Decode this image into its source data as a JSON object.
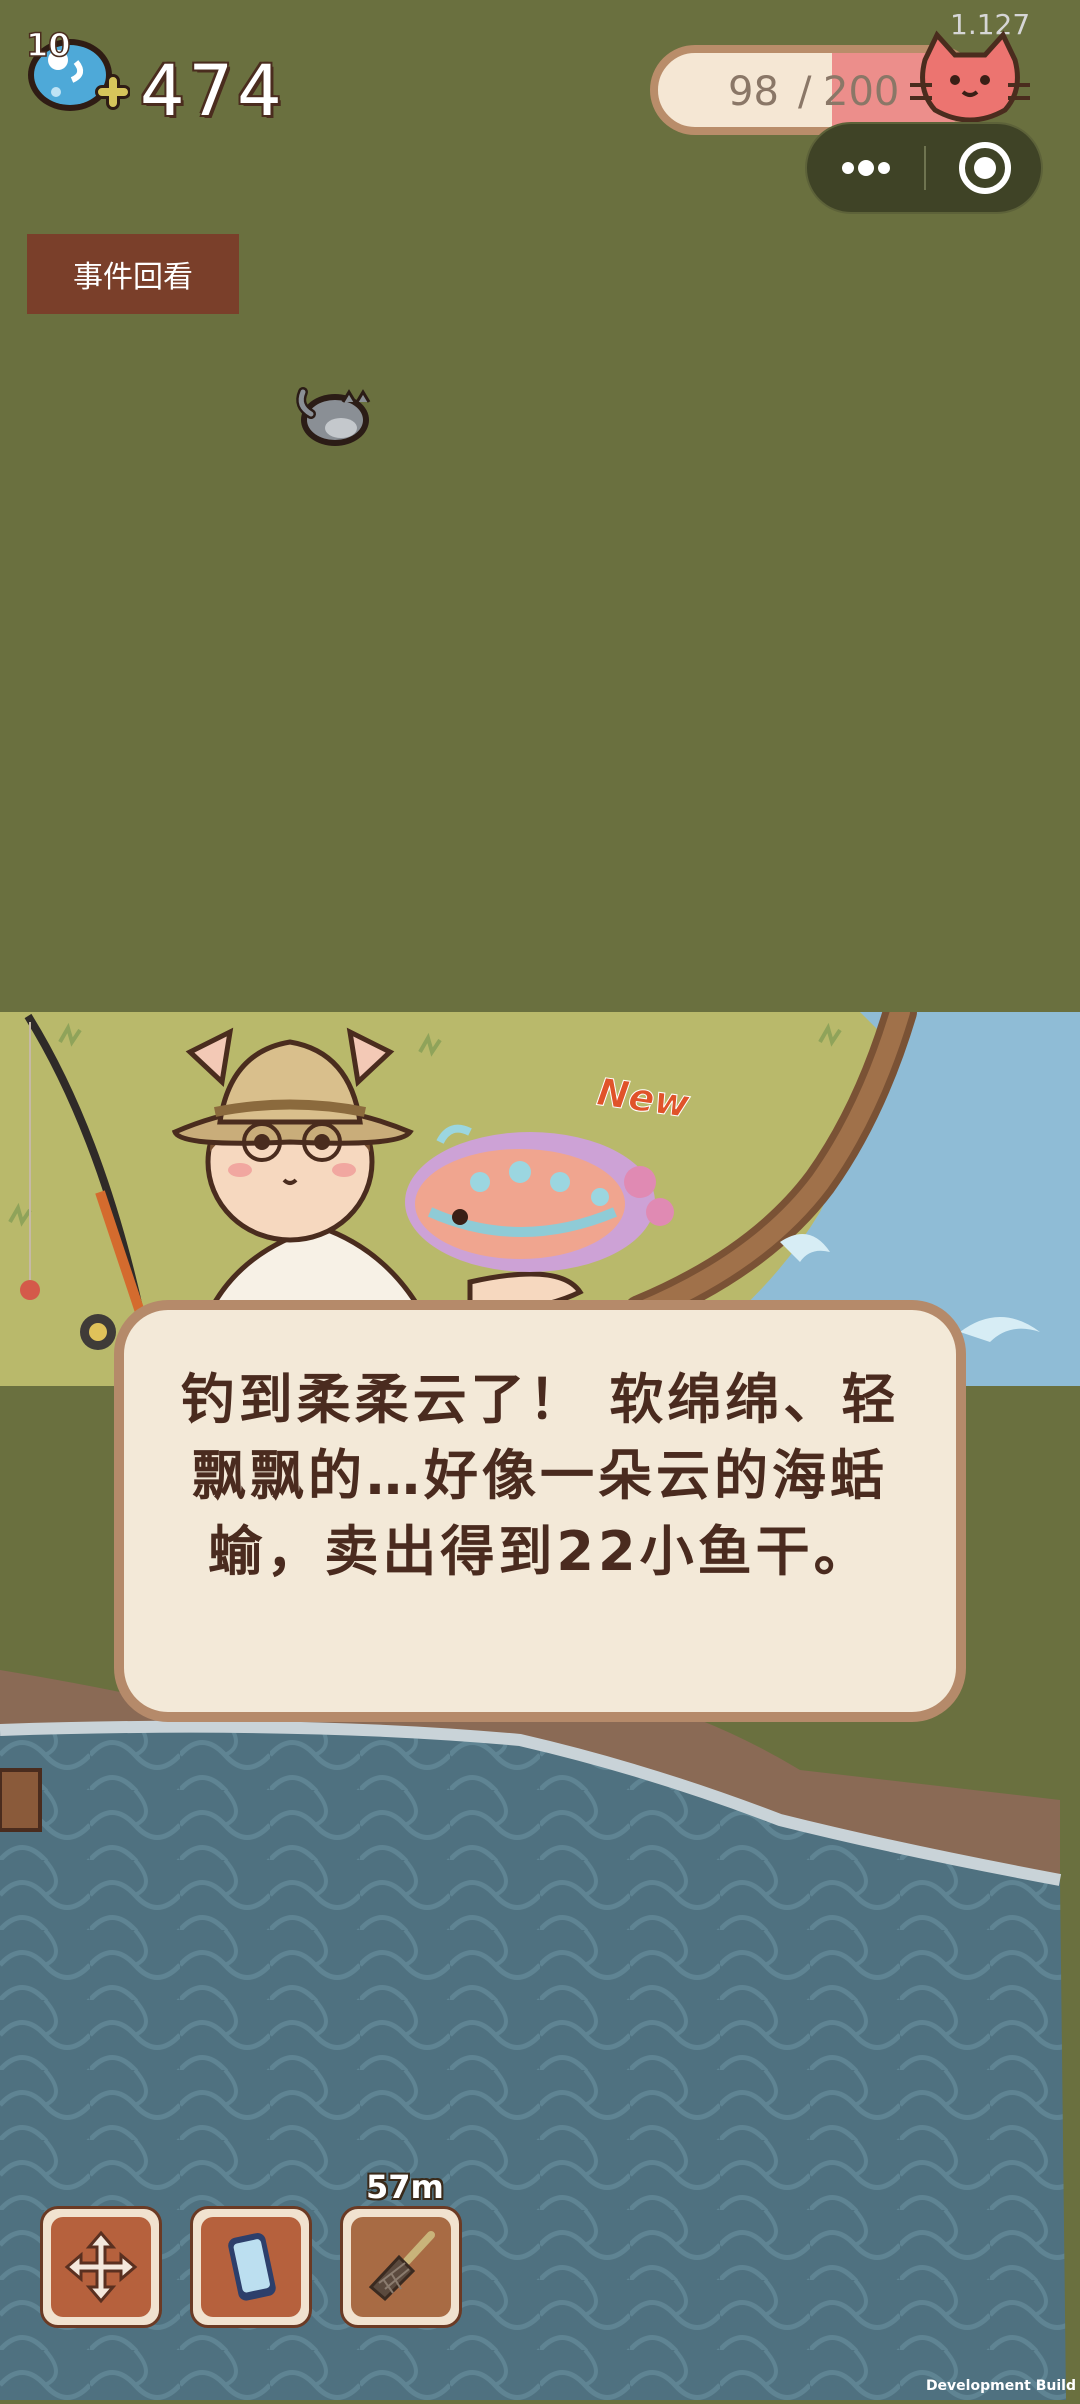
{
  "hud": {
    "fish_level": "10",
    "fish_count": "474",
    "version": "1.127",
    "energy": {
      "current": "98",
      "separator": "/",
      "max": "200"
    }
  },
  "capsule": {
    "more_icon": "more-dots-icon",
    "close_icon": "target-circle-icon"
  },
  "event_review_label": "事件回看",
  "scene": {
    "new_badge": "New"
  },
  "dialog": {
    "text": "钓到柔柔云了！ 软绵绵、轻飘飘的…好像一朵云的海蛞蝓，卖出得到22小鱼干。"
  },
  "toolbar": {
    "depth": "57m",
    "items": [
      {
        "icon": "move-arrows-icon"
      },
      {
        "icon": "phone-icon"
      },
      {
        "icon": "fishing-net-icon"
      }
    ]
  },
  "footer": {
    "dev_build": "Development Build"
  },
  "colors": {
    "background": "#6a703f",
    "dialog_bg": "#f3e9d8",
    "dialog_border": "#b58a6a",
    "energy_fill": "#ec8e8b",
    "event_button": "#7a3f2a",
    "lake": "#4f7180"
  }
}
